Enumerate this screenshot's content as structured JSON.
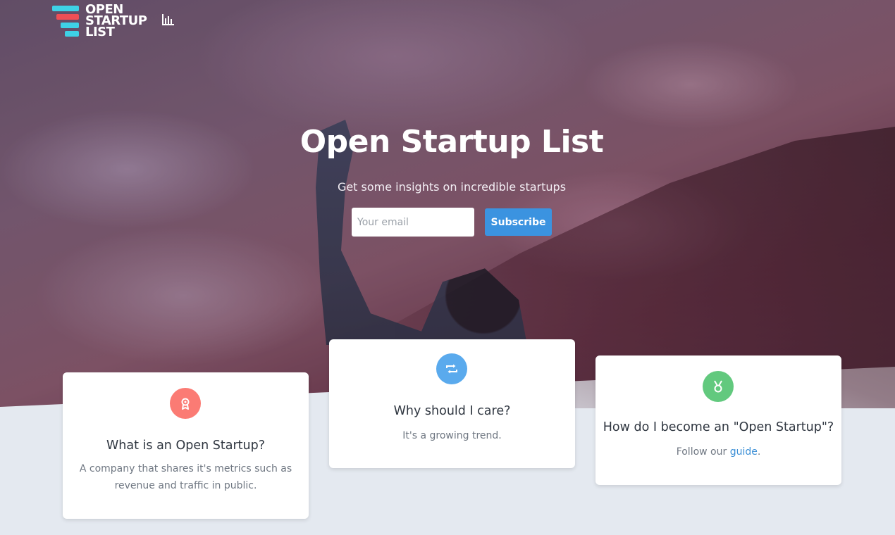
{
  "brand": {
    "logo_lines": [
      "OPEN",
      "STARTUP",
      "LIST"
    ],
    "colors": {
      "cyan": "#3ed2e6",
      "red": "#ef4f55"
    }
  },
  "nav": {
    "stats_icon": "bar-chart-icon"
  },
  "hero": {
    "title": "Open Startup List",
    "subtitle": "Get some insights on incredible startups",
    "email_placeholder": "Your email",
    "subscribe_label": "Subscribe",
    "accent_color": "#3b93e0"
  },
  "cards": [
    {
      "icon": "award-ribbon-icon",
      "color": "#fb7b74",
      "title": "What is an Open Startup?",
      "description": "A company that shares it's metrics such as revenue and traffic in public."
    },
    {
      "icon": "repeat-icon",
      "color": "#5aaaed",
      "title": "Why should I care?",
      "description": "It's a growing trend."
    },
    {
      "icon": "medal-icon",
      "color": "#62c97e",
      "title": "How do I become an \"Open Startup\"?",
      "description_prefix": "Follow our ",
      "description_link": "guide",
      "description_suffix": "."
    }
  ]
}
